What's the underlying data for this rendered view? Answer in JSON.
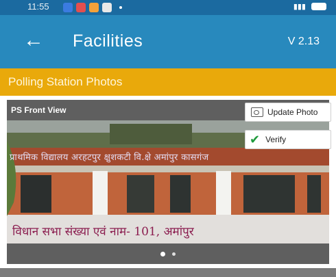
{
  "status_bar": {
    "time": "11:55",
    "icon_colors": [
      "#3b7be0",
      "#e24f4f",
      "#f4a23a",
      "#e8e8e8"
    ]
  },
  "app_bar": {
    "back_icon": "arrow-left-icon",
    "title": "Facilities",
    "version": "V 2.13",
    "background": "#2889bd"
  },
  "section": {
    "title": "Polling Station Photos",
    "background": "#e9a90b"
  },
  "photo_card": {
    "label": "PS Front View",
    "update_button": {
      "label": "Update Photo",
      "icon": "photo-icon"
    },
    "verify_button": {
      "label": "Verify",
      "icon": "checkmark-icon",
      "icon_color": "#1f9a3c"
    },
    "photo_text_top": "प्राथमिक विद्यालय अरहटपुर क्षुशकटी वि.क्षे अमांपुर कासगंज",
    "photo_text_bottom": "विधान सभा संख्या एवं नाम- 101, अमांपुर",
    "pager": {
      "count": 2,
      "active_index": 0
    }
  }
}
